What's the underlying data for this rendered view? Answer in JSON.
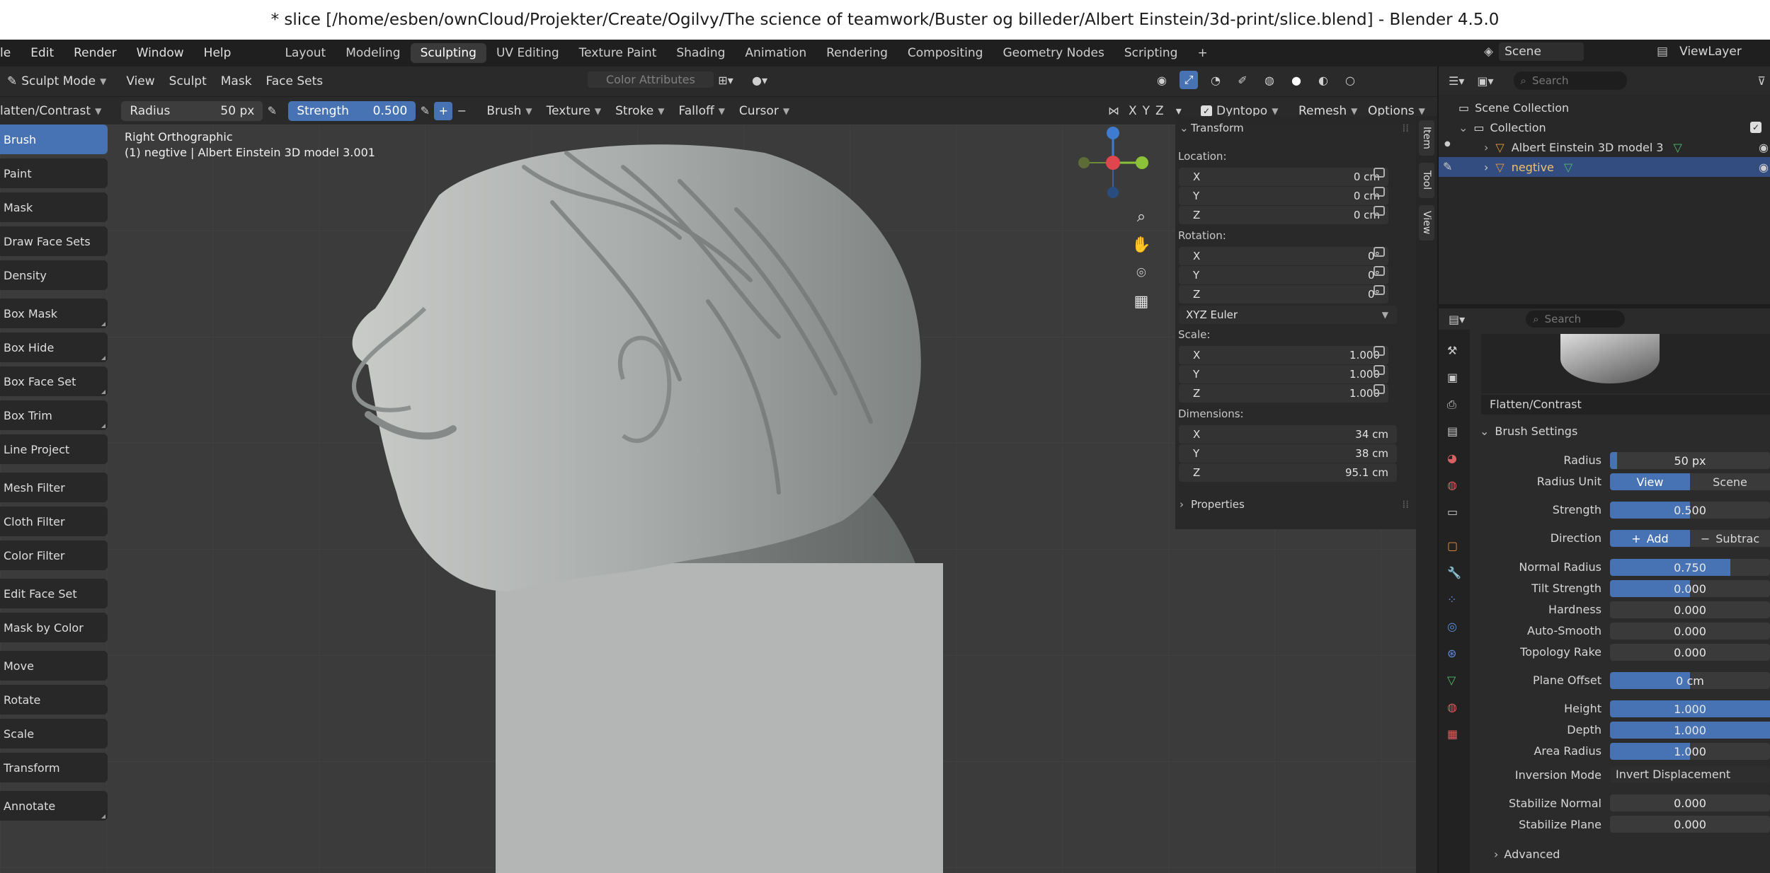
{
  "window_title": "* slice [/home/esben/ownCloud/Projekter/Create/Ogilvy/The science of teamwork/Buster og billeder/Albert Einstein/3d-print/slice.blend] - Blender 4.5.0",
  "menu": [
    "le",
    "Edit",
    "Render",
    "Window",
    "Help"
  ],
  "workspaces": [
    "Layout",
    "Modeling",
    "Sculpting",
    "UV Editing",
    "Texture Paint",
    "Shading",
    "Animation",
    "Rendering",
    "Compositing",
    "Geometry Nodes",
    "Scripting",
    "+"
  ],
  "active_workspace": "Sculpting",
  "scene": {
    "label": "Scene",
    "viewlayer": "ViewLayer"
  },
  "header": {
    "mode": "Sculpt Mode",
    "menus": [
      "View",
      "Sculpt",
      "Mask",
      "Face Sets"
    ],
    "color_attributes": "Color Attributes"
  },
  "tool_header": {
    "brush_name": "latten/Contrast",
    "radius_label": "Radius",
    "radius_value": "50 px",
    "strength_label": "Strength",
    "strength_value": "0.500",
    "plus": "+",
    "minus": "−",
    "menus": [
      "Brush",
      "Texture",
      "Stroke",
      "Falloff",
      "Cursor"
    ],
    "axes": [
      "X",
      "Y",
      "Z"
    ],
    "dyntopo": "Dyntopo",
    "remesh": "Remesh",
    "options": "Options"
  },
  "viewport": {
    "view_name": "Right Orthographic",
    "object_info": "(1) negtive | Albert Einstein 3D model 3.001"
  },
  "tools": [
    "Brush",
    "Paint",
    "Mask",
    "Draw Face Sets",
    "Density",
    "Box Mask",
    "Box Hide",
    "Box Face Set",
    "Box Trim",
    "Line Project",
    "Mesh Filter",
    "Cloth Filter",
    "Color Filter",
    "Edit Face Set",
    "Mask by Color",
    "Move",
    "Rotate",
    "Scale",
    "Transform",
    "Annotate"
  ],
  "active_tool": "Brush",
  "transform": {
    "title": "Transform",
    "location_label": "Location:",
    "location": [
      {
        "axis": "X",
        "value": "0 cm"
      },
      {
        "axis": "Y",
        "value": "0 cm"
      },
      {
        "axis": "Z",
        "value": "0 cm"
      }
    ],
    "rotation_label": "Rotation:",
    "rotation": [
      {
        "axis": "X",
        "value": "0°"
      },
      {
        "axis": "Y",
        "value": "0°"
      },
      {
        "axis": "Z",
        "value": "0°"
      }
    ],
    "rotation_mode": "XYZ Euler",
    "scale_label": "Scale:",
    "scale": [
      {
        "axis": "X",
        "value": "1.000"
      },
      {
        "axis": "Y",
        "value": "1.000"
      },
      {
        "axis": "Z",
        "value": "1.000"
      }
    ],
    "dimensions_label": "Dimensions:",
    "dimensions": [
      {
        "axis": "X",
        "value": "34 cm"
      },
      {
        "axis": "Y",
        "value": "38 cm"
      },
      {
        "axis": "Z",
        "value": "95.1 cm"
      }
    ],
    "properties": "Properties"
  },
  "side_tabs": [
    "Item",
    "Tool",
    "View"
  ],
  "outliner": {
    "search_placeholder": "Search",
    "scene_collection": "Scene Collection",
    "collection": "Collection",
    "items": [
      "Albert Einstein 3D model 3",
      "negtive"
    ]
  },
  "properties": {
    "search_placeholder": "Search",
    "brush_name": "Flatten/Contrast",
    "section": "Brush Settings",
    "radius": {
      "label": "Radius",
      "value": "50 px"
    },
    "radius_unit": {
      "label": "Radius Unit",
      "options": [
        "View",
        "Scene"
      ]
    },
    "strength": {
      "label": "Strength",
      "value": "0.500",
      "fill": 0.5
    },
    "direction": {
      "label": "Direction",
      "options": [
        "Add",
        "Subtrac"
      ]
    },
    "rows": [
      {
        "label": "Normal Radius",
        "value": "0.750",
        "fill": 0.75
      },
      {
        "label": "Tilt Strength",
        "value": "0.000",
        "fill": 0.5
      },
      {
        "label": "Hardness",
        "value": "0.000",
        "fill": 0
      },
      {
        "label": "Auto-Smooth",
        "value": "0.000",
        "fill": 0
      },
      {
        "label": "Topology Rake",
        "value": "0.000",
        "fill": 0
      },
      {
        "label": "Plane Offset",
        "value": "0 cm",
        "fill": 0.5
      },
      {
        "label": "Height",
        "value": "1.000",
        "fill": 1
      },
      {
        "label": "Depth",
        "value": "1.000",
        "fill": 1
      },
      {
        "label": "Area Radius",
        "value": "1.000",
        "fill": 0.5
      }
    ],
    "inversion": {
      "label": "Inversion Mode",
      "value": "Invert Displacement"
    },
    "stabilize_normal": {
      "label": "Stabilize Normal",
      "value": "0.000"
    },
    "stabilize_plane": {
      "label": "Stabilize Plane",
      "value": "0.000"
    },
    "advanced": "Advanced"
  },
  "colors": {
    "accent": "#4772b3",
    "axis_x": "#e0464e",
    "axis_y": "#8bc23a",
    "axis_z": "#3f7bd1"
  }
}
